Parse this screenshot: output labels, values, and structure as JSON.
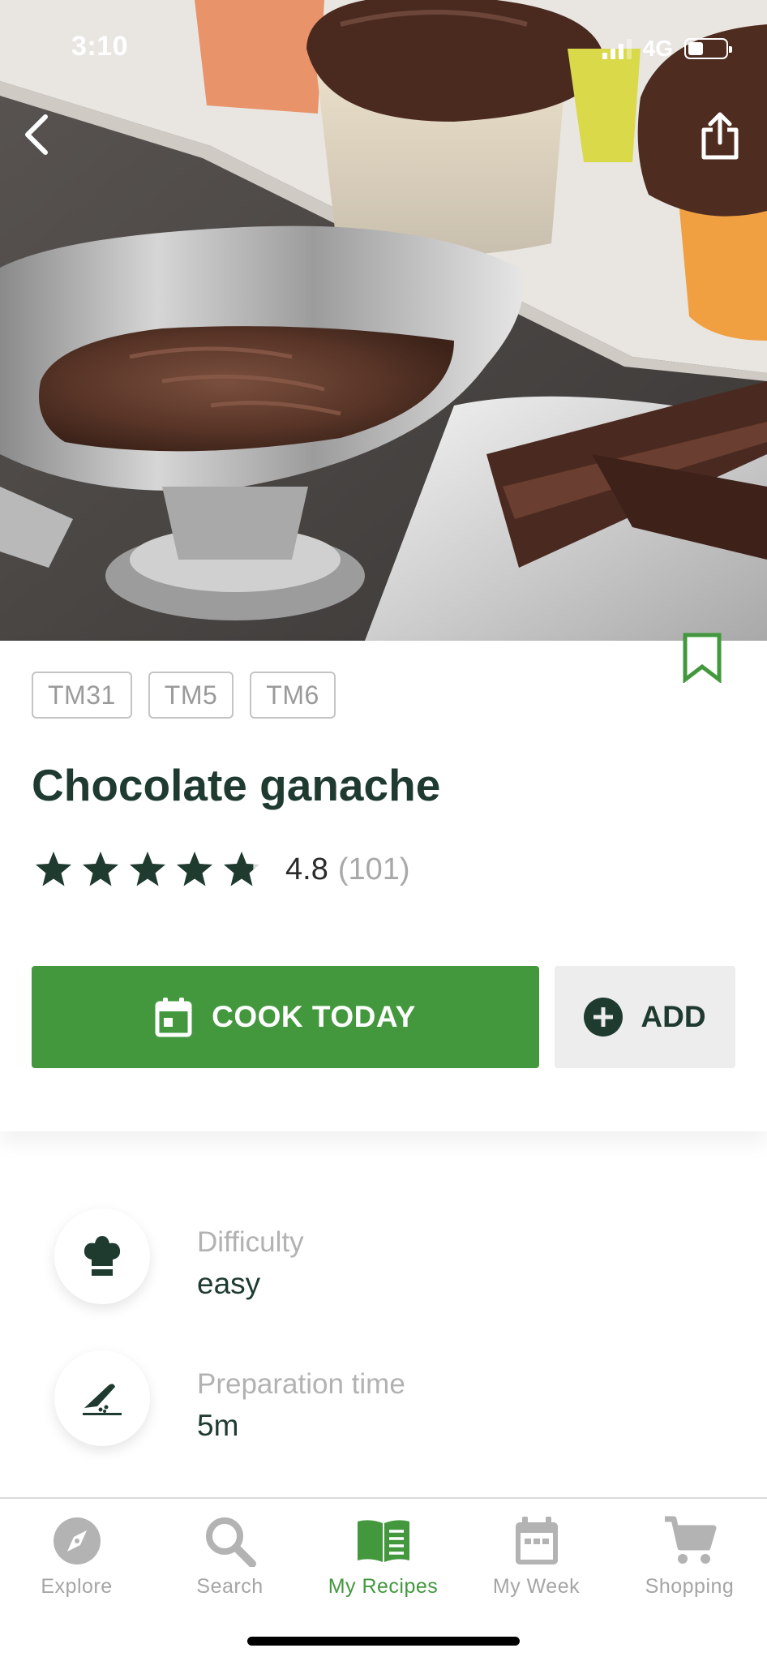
{
  "status_bar": {
    "time": "3:10",
    "network": "4G",
    "battery_level": 0.4
  },
  "hero": {
    "back_icon": "chevron-left-icon",
    "share_icon": "share-icon"
  },
  "recipe": {
    "tags": [
      "TM31",
      "TM5",
      "TM6"
    ],
    "title": "Chocolate ganache",
    "rating_value": "4.8",
    "rating_count": "(101)",
    "rating_stars": 4.8,
    "bookmark_icon": "bookmark-icon"
  },
  "actions": {
    "cook_today": "COOK TODAY",
    "add": "ADD"
  },
  "info": [
    {
      "icon": "chef-hat-icon",
      "label": "Difficulty",
      "value": "easy"
    },
    {
      "icon": "knife-icon",
      "label": "Preparation time",
      "value": "5m"
    }
  ],
  "tabbar": {
    "items": [
      {
        "label": "Explore",
        "icon": "compass-icon"
      },
      {
        "label": "Search",
        "icon": "search-icon"
      },
      {
        "label": "My Recipes",
        "icon": "book-icon",
        "active": true
      },
      {
        "label": "My Week",
        "icon": "calendar-icon"
      },
      {
        "label": "Shopping",
        "icon": "cart-icon"
      }
    ]
  },
  "colors": {
    "accent_green": "#43983e",
    "dark_green": "#1f3b30"
  }
}
